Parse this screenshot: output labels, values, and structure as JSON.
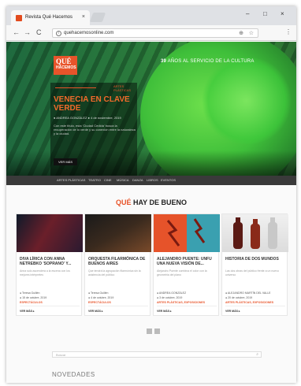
{
  "browser": {
    "tab_title": "Revista Qué Hacemos",
    "tab_close": "×",
    "window_controls": [
      "–",
      "□",
      "×"
    ],
    "nav": [
      "←",
      "→",
      "C"
    ],
    "url": "quehacemosonline.com",
    "info_icon": "i",
    "zoom_icon": "⊕",
    "star_icon": "☆",
    "menu_icon": "⋮"
  },
  "hero": {
    "logo_top": "QUÉ",
    "logo_bottom": "HACEMOS",
    "tagline_num": "39",
    "tagline_rest": " AÑOS AL SERVICIO DE LA CULTURA",
    "kicker": "ARTES PLÁSTICAS",
    "title": "VENECIA EN CLAVE VERDE",
    "meta": "● ANDREA GONZÁLEZ ● 4 de noviembre, 2019",
    "excerpt": "Con este título, esta 'Ciudad Cedida' busca la recuperación de lo verde y su conexión entre la naturaleza y la ciudad.",
    "button": "VER MÁS"
  },
  "categories": [
    "ARTES PLÁSTICAS",
    "TEATRO",
    "CINE",
    "MÚSICA",
    "DANZA",
    "LIBROS",
    "EVENTOS"
  ],
  "section": {
    "title_accent": "QUÉ",
    "title_rest": " HAY DE BUENO"
  },
  "cards": [
    {
      "title": "DIVA LÍRICA CON ANNA NETREBKO 'SOPRANO' Y...",
      "text": "Anna solo ascenderá a la escena con los mejores intérpretes",
      "meta1": "● Teresa Guillén",
      "meta2": "● 15 de octubre, 2019",
      "category": "ESPECTÁCULOS",
      "more": "VER MÁS ▸"
    },
    {
      "title": "ORQUESTA FILARMÓNICA DE BUENOS AIRES",
      "text": "Que tendrá la agrupación filarmónica sin la asistencia del público",
      "meta1": "● Teresa Guillén",
      "meta2": "● 4 de octubre, 2019",
      "category": "ESPECTÁCULOS",
      "more": "VER MÁS ▸"
    },
    {
      "title": "ALEJANDRO PUENTE: UNFU UNA NUEVA VISIÓN DE...",
      "text": "Alejandro Puente combina el color con la geometría del plano",
      "meta1": "● ANDREA GONZÁLEZ",
      "meta2": "● 3 de octubre, 2019",
      "category": "ARTES PLÁSTICAS, EXPOSICIONES",
      "more": "VER MÁS ▸"
    },
    {
      "title": "HISTORIA DE DOS MUNDOS",
      "text": "Las dos obras del público frente a un nuevo universo",
      "meta1": "● ALEJANDRO MARTÍN DEL VALLE",
      "meta2": "● 20 de octubre, 2019",
      "category": "ARTES PLÁSTICAS, EXPOSICIONES",
      "more": "VER MÁS ▸"
    }
  ],
  "search": {
    "placeholder": "Buscar",
    "icon": "⌕"
  },
  "novedades": "NOVEDADES",
  "colors": {
    "accent": "#e8542a",
    "hero_green": "#2a7a3c",
    "nav_dark": "#3a3a3a"
  }
}
